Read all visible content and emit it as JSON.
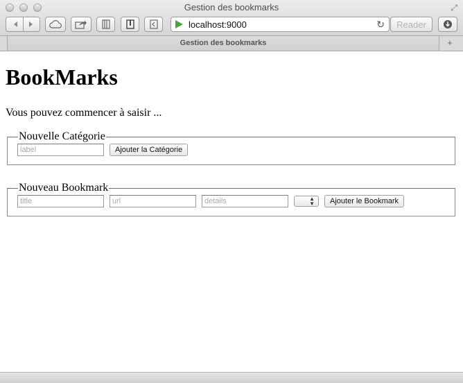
{
  "window": {
    "title": "Gestion des bookmarks"
  },
  "toolbar": {
    "back_icon": "chevron-left-icon",
    "forward_icon": "chevron-right-icon",
    "url": "localhost:9000",
    "reader_label": "Reader"
  },
  "tab": {
    "title": "Gestion des bookmarks",
    "new_tab_symbol": "+"
  },
  "page": {
    "heading": "BookMarks",
    "intro": "Vous pouvez commencer à saisir ...",
    "category_form": {
      "legend": "Nouvelle Catégorie",
      "label_placeholder": "label",
      "label_value": "",
      "submit_label": "Ajouter la Catégorie"
    },
    "bookmark_form": {
      "legend": "Nouveau Bookmark",
      "title_placeholder": "title",
      "url_placeholder": "url",
      "details_placeholder": "details",
      "category_selected": "",
      "submit_label": "Ajouter le Bookmark"
    }
  },
  "colors": {
    "url_indicator": "#3fae36",
    "disabled_text": "#b5b5b5"
  }
}
